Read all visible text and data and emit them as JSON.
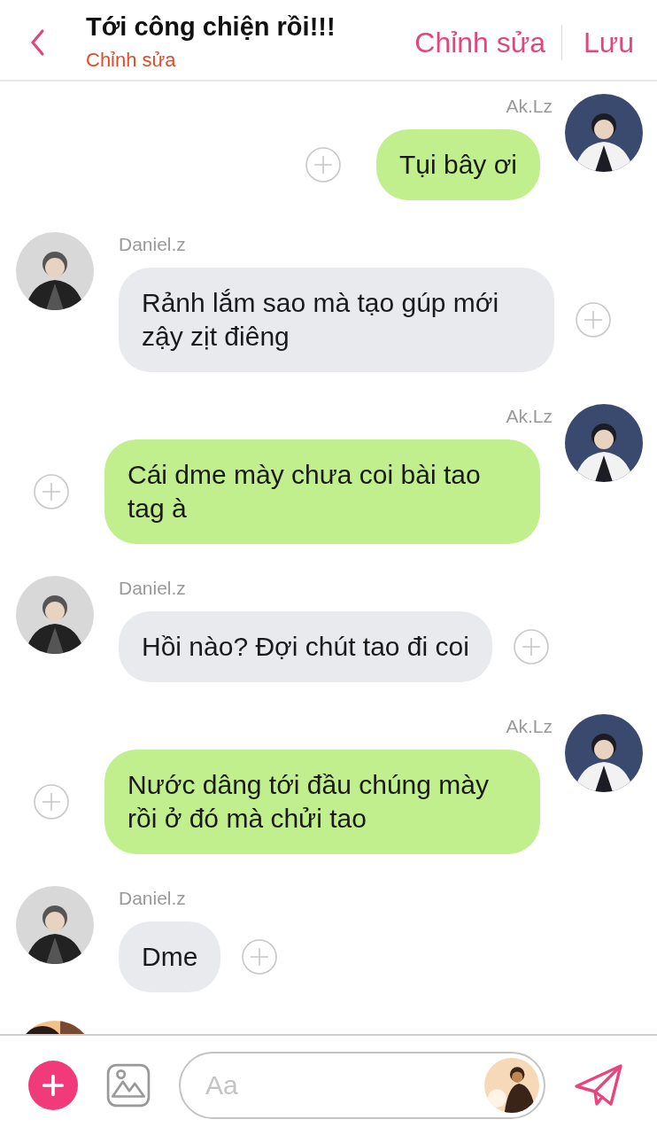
{
  "header": {
    "title": "Tới công chiện rồi!!!",
    "subtitle": "Chỉnh sửa",
    "actions": [
      "Chỉnh sửa",
      "Lưu"
    ]
  },
  "messages": [
    {
      "kind": "outgoing",
      "sender": "Ak.Lz",
      "text": "Tụi bây ơi"
    },
    {
      "kind": "incoming",
      "sender": "Daniel.z",
      "text": "Rảnh lắm sao mà tạo gúp mới zậy zịt điêng"
    },
    {
      "kind": "outgoing",
      "sender": "Ak.Lz",
      "text": "Cái dme mày chưa coi bài tao tag à"
    },
    {
      "kind": "incoming",
      "sender": "Daniel.z",
      "text": "Hồi nào? Đợi chút tao đi coi"
    },
    {
      "kind": "outgoing",
      "sender": "Ak.Lz",
      "text": "Nước dâng tới đầu chúng mày rồi ở đó mà chửi tao"
    },
    {
      "kind": "incoming",
      "sender": "Daniel.z",
      "text": "Dme"
    },
    {
      "kind": "cut"
    }
  ],
  "composer": {
    "placeholder": "Aa"
  }
}
